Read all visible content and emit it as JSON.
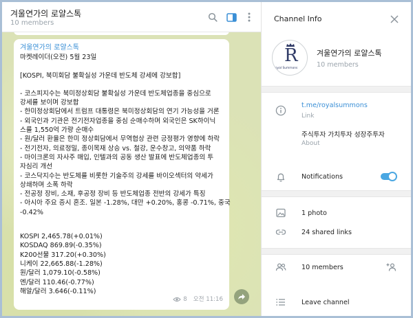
{
  "chat": {
    "title": "겨울연가의 로얄스톡",
    "subtitle": "10 members",
    "message": {
      "author": "겨울연가의 로얄스톡",
      "lines_a": [
        "마켓레이더(오전) 5월 23일"
      ],
      "lines_b": [
        "[KOSPI, 북미회담 불확실성 가운데 반도체 강세에 강보합]"
      ],
      "lines_c": [
        "- 코스피지수는 북미정상회담 불확실성 가운데 반도체업종을 중심으로",
        "강세를 보이며 강보합",
        "- 한미정상회담에서 트럼프 대통령은 북미정상회담의 연기 가능성을 거론",
        "- 외국인과 기관은 전기전자업종을 중심 순매수하며 외국인은 SK하이닉",
        "스를 1,550억 가량 순매수",
        "- 원/달러 환율은 한미 정상회담에서 무역협상 관련 긍정평가 영향에 하락",
        "- 전기전자, 의료정밀, 종이목재 상승 vs. 철강, 운수창고, 의약품 하락",
        "- 마이크론의 자사주 매입, 인텔과의 공동 생산 발표에 반도체업종의 투",
        "자심리 개선",
        "- 코스닥지수는 반도체를 비롯한 기술주의 강세를 바이오섹터의 약세가",
        "상쇄하며 소폭 하락",
        "- 전공정 장비, 소재, 후공정 장비 등 반도체업종 전반의 강세가 특징",
        "- 아시아 주요 증시 혼조. 일본 -1.28%, 대만 +0.20%, 홍콩 -0.71%, 중국",
        "-0.42%"
      ],
      "lines_d": [
        "KOSPI 2,465.78(+0.01%)",
        "KOSDAQ 869.89(-0.35%)",
        "K200선물 317.20(+0.30%)",
        "니케이 22,665.88(-1.28%)",
        "원/달러 1,079.10(-0.58%)",
        "엔/달러 110.46(-0.77%)",
        "해알/달러 3.646(-0.11%)"
      ],
      "views": "8",
      "time": "오전 11:16"
    }
  },
  "panel": {
    "title": "Channel Info",
    "channel_name": "겨울연가의 로얄스톡",
    "members": "10 members",
    "avatar_letter": "R",
    "avatar_text": "Royal Summons",
    "link_value": "t.me/royalsummons",
    "link_label": "Link",
    "about_value": "주식투자 가치투자 성장주투자",
    "about_label": "About",
    "notifications_label": "Notifications",
    "notifications_on": true,
    "photos_label": "1 photo",
    "links_label": "24 shared links",
    "members_label": "10 members",
    "leave_label": "Leave channel"
  },
  "colors": {
    "accent": "#3a8fd6",
    "toggle": "#4aa7e2"
  }
}
